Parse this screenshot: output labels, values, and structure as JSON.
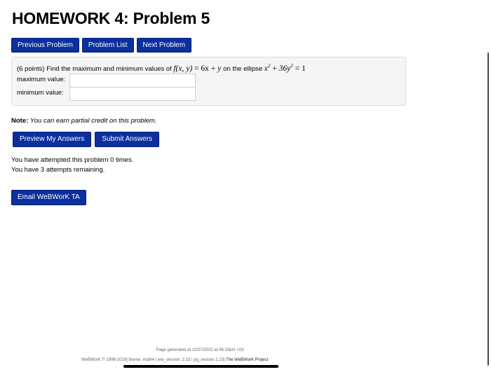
{
  "page": {
    "title": "HOMEWORK 4: Problem 5"
  },
  "nav": {
    "previous": "Previous Problem",
    "list": "Problem List",
    "next": "Next Problem"
  },
  "problem": {
    "points": "(6 points) Find the maximum and minimum values of",
    "function_lhs": "f(x, y)",
    "eq1": "=",
    "coef1": "6x",
    "plus1": "+",
    "var_y": "y",
    "on_ellipse": "on the ellipse",
    "ellipse_x": "x",
    "exp_x": "2",
    "plus2": "+",
    "ellipse_y": "36y",
    "exp_y": "2",
    "eq2": "=",
    "rhs": "1",
    "max_label": "maximum value:",
    "max_value": "",
    "min_label": "minimum value:",
    "min_value": ""
  },
  "note": {
    "label": "Note:",
    "text": "You can earn partial credit on this problem."
  },
  "actions": {
    "preview": "Preview My Answers",
    "submit": "Submit Answers"
  },
  "attempts": {
    "line1": "You have attempted this problem 0 times.",
    "line2": "You have 3 attempts remaining."
  },
  "email": {
    "label": "Email WeBWorK TA"
  },
  "footer": {
    "generated": "Page generated at 12/27/2022 at 06:19pm +03",
    "credits": "WeBWorK © 1996-2019| theme: math4 | ww_version: 2.15 | pg_version 2.15|",
    "project": "The WeBWorK Project"
  },
  "colors": {
    "button": "#0b2f9d",
    "panel": "#f5f5f5"
  }
}
